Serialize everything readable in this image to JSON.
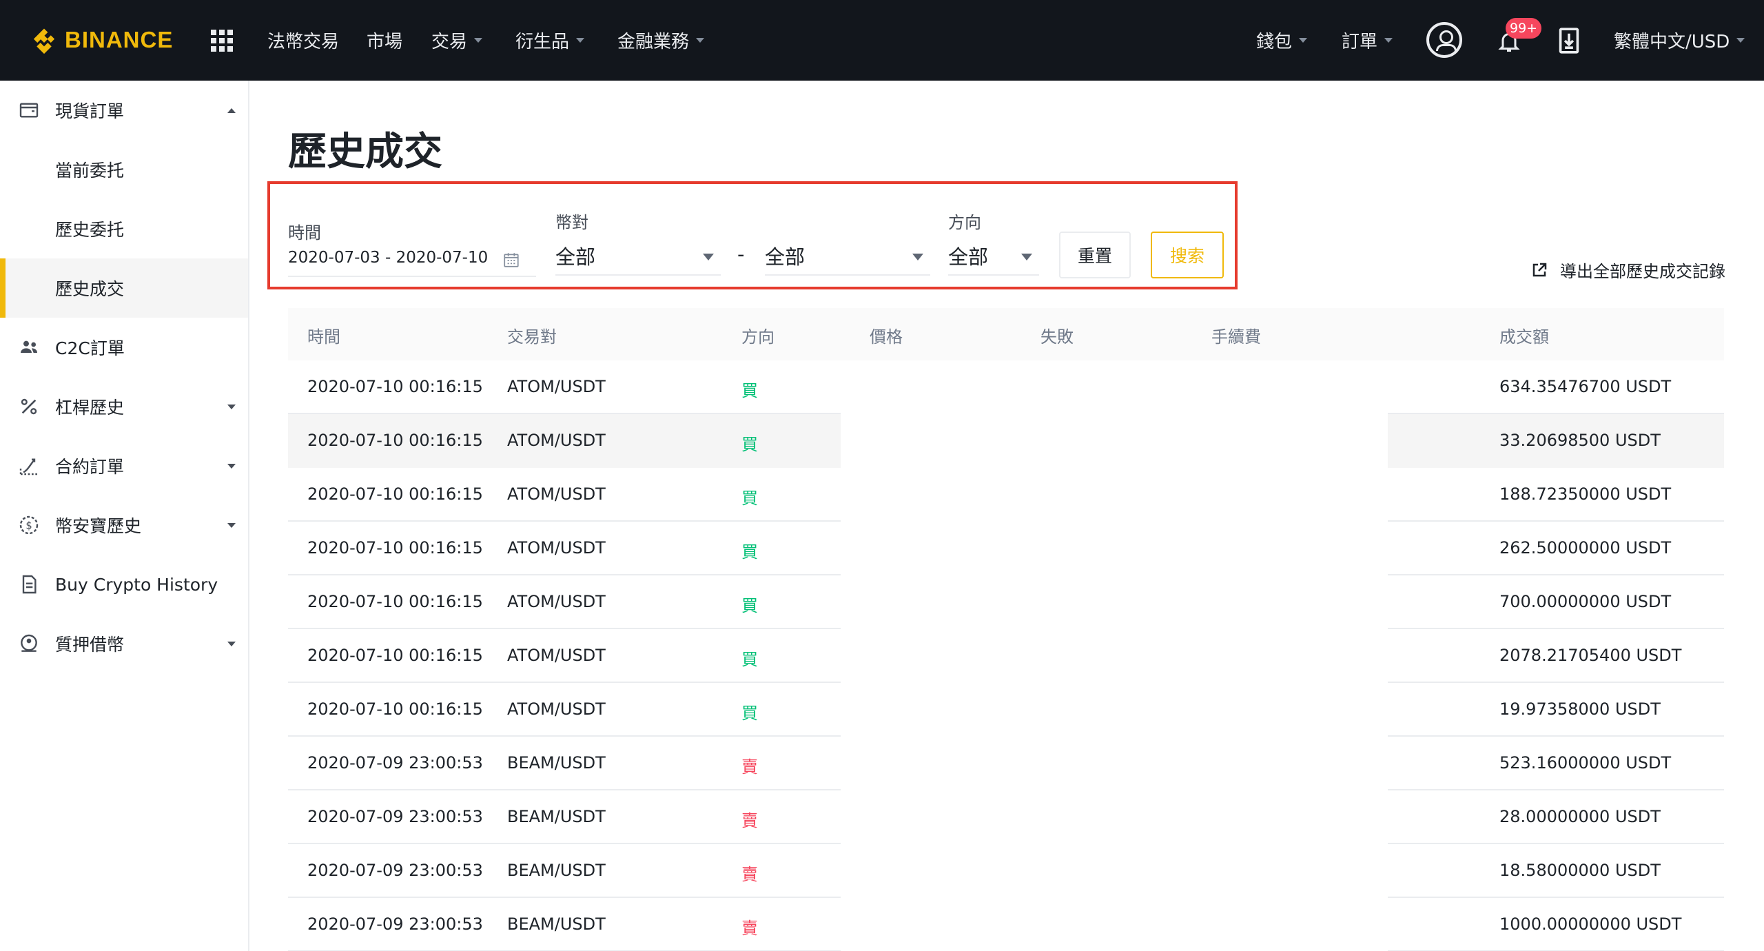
{
  "header": {
    "logo_text": "BINANCE",
    "nav": [
      {
        "label": "法幣交易",
        "has_caret": false
      },
      {
        "label": "市場",
        "has_caret": false
      },
      {
        "label": "交易",
        "has_caret": true
      },
      {
        "label": "衍生品",
        "has_caret": true
      },
      {
        "label": "金融業務",
        "has_caret": true
      }
    ],
    "wallet_label": "錢包",
    "orders_label": "訂單",
    "notification_badge": "99+",
    "language_label": "繁體中文/USD",
    "colors": {
      "bg": "#12161c",
      "brand": "#f0b90b",
      "badge": "#f6465d"
    }
  },
  "sidebar": {
    "items": [
      {
        "label": "現貨訂單",
        "icon": "wallet-icon",
        "caret": "up",
        "level": 1
      },
      {
        "label": "當前委托",
        "level": 2
      },
      {
        "label": "歷史委托",
        "level": 2
      },
      {
        "label": "歷史成交",
        "level": 2,
        "active": true
      },
      {
        "label": "C2C訂單",
        "icon": "users-icon",
        "level": 1
      },
      {
        "label": "杠桿歷史",
        "icon": "percent-icon",
        "caret": "down",
        "level": 1
      },
      {
        "label": "合約訂單",
        "icon": "futures-icon",
        "caret": "down",
        "level": 1
      },
      {
        "label": "幣安寶歷史",
        "icon": "savings-icon",
        "caret": "down",
        "level": 1
      },
      {
        "label": "Buy Crypto History",
        "icon": "document-icon",
        "level": 1
      },
      {
        "label": "質押借幣",
        "icon": "loan-icon",
        "caret": "down",
        "level": 1
      }
    ]
  },
  "page": {
    "title": "歷史成交",
    "filters": {
      "time_label": "時間",
      "time_value": "2020-07-03 - 2020-07-10",
      "pair_label": "幣對",
      "pair_base": "全部",
      "pair_separator": "-",
      "pair_quote": "全部",
      "side_label": "方向",
      "side_value": "全部",
      "reset_label": "重置",
      "search_label": "搜索"
    },
    "export_label": "導出全部歷史成交記錄"
  },
  "table": {
    "headers": [
      "時間",
      "交易對",
      "方向",
      "價格",
      "失敗",
      "手續費",
      "成交額"
    ],
    "rows": [
      {
        "time": "2020-07-10 00:16:15",
        "pair": "ATOM/USDT",
        "side": "買",
        "side_type": "buy",
        "total": "634.35476700 USDT"
      },
      {
        "time": "2020-07-10 00:16:15",
        "pair": "ATOM/USDT",
        "side": "買",
        "side_type": "buy",
        "total": "33.20698500 USDT",
        "hovered": true
      },
      {
        "time": "2020-07-10 00:16:15",
        "pair": "ATOM/USDT",
        "side": "買",
        "side_type": "buy",
        "total": "188.72350000 USDT"
      },
      {
        "time": "2020-07-10 00:16:15",
        "pair": "ATOM/USDT",
        "side": "買",
        "side_type": "buy",
        "total": "262.50000000 USDT"
      },
      {
        "time": "2020-07-10 00:16:15",
        "pair": "ATOM/USDT",
        "side": "買",
        "side_type": "buy",
        "total": "700.00000000 USDT"
      },
      {
        "time": "2020-07-10 00:16:15",
        "pair": "ATOM/USDT",
        "side": "買",
        "side_type": "buy",
        "total": "2078.21705400 USDT"
      },
      {
        "time": "2020-07-10 00:16:15",
        "pair": "ATOM/USDT",
        "side": "買",
        "side_type": "buy",
        "total": "19.97358000 USDT"
      },
      {
        "time": "2020-07-09 23:00:53",
        "pair": "BEAM/USDT",
        "side": "賣",
        "side_type": "sell",
        "total": "523.16000000 USDT"
      },
      {
        "time": "2020-07-09 23:00:53",
        "pair": "BEAM/USDT",
        "side": "賣",
        "side_type": "sell",
        "total": "28.00000000 USDT"
      },
      {
        "time": "2020-07-09 23:00:53",
        "pair": "BEAM/USDT",
        "side": "賣",
        "side_type": "sell",
        "total": "18.58000000 USDT"
      },
      {
        "time": "2020-07-09 23:00:53",
        "pair": "BEAM/USDT",
        "side": "賣",
        "side_type": "sell",
        "total": "1000.00000000 USDT"
      }
    ],
    "colors": {
      "buy": "#02c076",
      "sell": "#f6465d"
    }
  }
}
